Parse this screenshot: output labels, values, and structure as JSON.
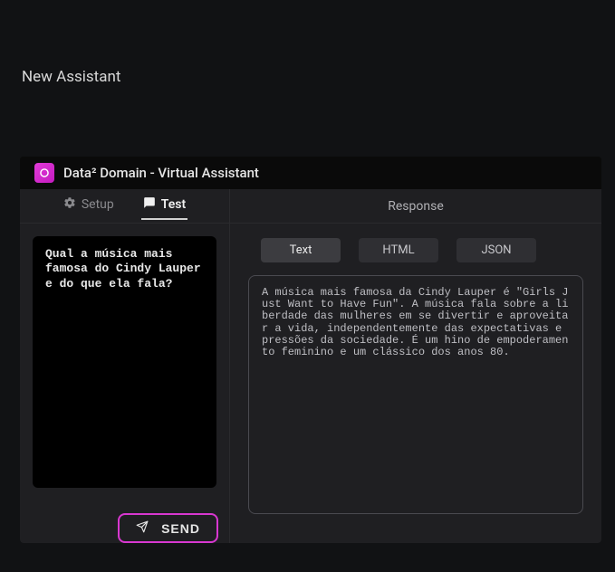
{
  "page": {
    "title": "New Assistant"
  },
  "panel": {
    "title": "Data²  Domain - Virtual Assistant"
  },
  "tabs": {
    "setup": "Setup",
    "test": "Test"
  },
  "response_header": "Response",
  "prompt": {
    "text": "Qual a música mais famosa do Cindy Lauper e do que ela fala?"
  },
  "send_label": "SEND",
  "formats": {
    "text": "Text",
    "html": "HTML",
    "json": "JSON"
  },
  "response": {
    "text": "A música mais famosa da Cindy Lauper é \"Girls Just Want to Have Fun\". A música fala sobre a liberdade das mulheres em se divertir e aproveitar a vida, independentemente das expectativas e pressões da sociedade. É um hino de empoderamento feminino e um clássico dos anos 80."
  }
}
